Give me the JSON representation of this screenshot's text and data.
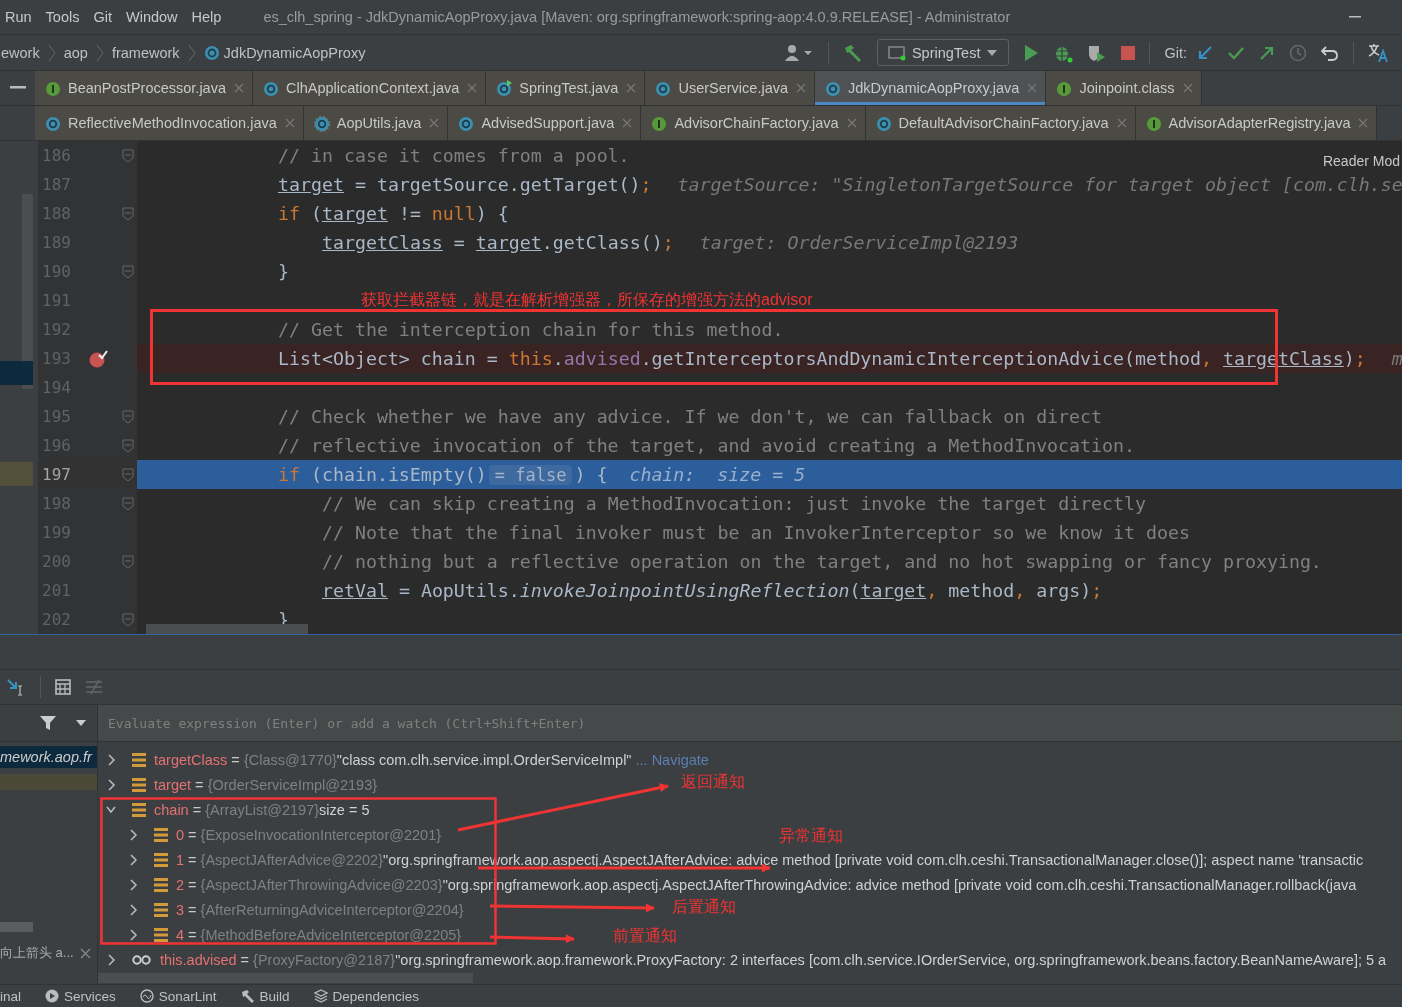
{
  "menu": [
    "Run",
    "Tools",
    "Git",
    "Window",
    "Help"
  ],
  "window": {
    "title": "es_clh_spring - JdkDynamicAopProxy.java [Maven: org.springframework:spring-aop:4.0.9.RELEASE] - Administrator"
  },
  "breadcrumbs": [
    "ework",
    "aop",
    "framework",
    "JdkDynamicAopProxy"
  ],
  "run_config": "SpringTest",
  "git_label": "Git:",
  "tab_rows": [
    [
      {
        "label": "BeanPostProcessor.java",
        "kind": "interface",
        "selected": false
      },
      {
        "label": "ClhApplicationContext.java",
        "kind": "class",
        "selected": false
      },
      {
        "label": "SpringTest.java",
        "kind": "runnable",
        "selected": false
      },
      {
        "label": "UserService.java",
        "kind": "class",
        "selected": false
      },
      {
        "label": "JdkDynamicAopProxy.java",
        "kind": "class",
        "selected": true
      },
      {
        "label": "Joinpoint.class",
        "kind": "interface",
        "selected": false
      }
    ],
    [
      {
        "label": "ReflectiveMethodInvocation.java",
        "kind": "class",
        "selected": false
      },
      {
        "label": "AopUtils.java",
        "kind": "abstract",
        "selected": false
      },
      {
        "label": "AdvisedSupport.java",
        "kind": "class",
        "selected": false
      },
      {
        "label": "AdvisorChainFactory.java",
        "kind": "interface",
        "selected": false
      },
      {
        "label": "DefaultAdvisorChainFactory.java",
        "kind": "class",
        "selected": false
      },
      {
        "label": "AdvisorAdapterRegistry.java",
        "kind": "interface",
        "selected": false
      }
    ]
  ],
  "reader_mode": "Reader Mod",
  "code_lines": [
    {
      "number": "186",
      "nested": false,
      "fold": true,
      "breakpoint": false,
      "current": false,
      "tokens": [
        {
          "kind": "comment",
          "text": "// in case it comes from a pool."
        }
      ]
    },
    {
      "number": "187",
      "nested": false,
      "fold": false,
      "breakpoint": false,
      "current": false,
      "tokens": [
        {
          "kind": "var",
          "text": "target"
        },
        {
          "kind": "plain",
          "text": " = targetSource.getTarget()"
        },
        {
          "kind": "punct",
          "text": ";"
        },
        {
          "kind": "hint",
          "text": "targetSource: \"SingletonTargetSource for target object [com.clh.se"
        }
      ]
    },
    {
      "number": "188",
      "nested": false,
      "fold": true,
      "breakpoint": false,
      "current": false,
      "tokens": [
        {
          "kind": "kw",
          "text": "if"
        },
        {
          "kind": "plain",
          "text": " ("
        },
        {
          "kind": "var",
          "text": "target"
        },
        {
          "kind": "plain",
          "text": " != "
        },
        {
          "kind": "kw",
          "text": "null"
        },
        {
          "kind": "plain",
          "text": ") {"
        }
      ]
    },
    {
      "number": "189",
      "nested": true,
      "fold": false,
      "breakpoint": false,
      "current": false,
      "tokens": [
        {
          "kind": "var",
          "text": "targetClass"
        },
        {
          "kind": "plain",
          "text": " = "
        },
        {
          "kind": "var",
          "text": "target"
        },
        {
          "kind": "plain",
          "text": ".getClass()"
        },
        {
          "kind": "punct",
          "text": ";"
        },
        {
          "kind": "hint",
          "text": "target: OrderServiceImpl@2193"
        }
      ]
    },
    {
      "number": "190",
      "nested": false,
      "fold": true,
      "breakpoint": false,
      "current": false,
      "tokens": [
        {
          "kind": "plain",
          "text": "}"
        }
      ]
    },
    {
      "number": "191",
      "nested": false,
      "fold": false,
      "breakpoint": false,
      "current": false,
      "tokens": [
        {
          "kind": "note",
          "text": "获取拦截器链，就是在解析增强器，所保存的增强方法的advisor"
        }
      ]
    },
    {
      "number": "192",
      "nested": false,
      "fold": false,
      "breakpoint": false,
      "current": false,
      "tokens": [
        {
          "kind": "comment",
          "text": "// Get the interception chain for this method."
        }
      ]
    },
    {
      "number": "193",
      "nested": false,
      "fold": false,
      "breakpoint": true,
      "current": false,
      "tokens": [
        {
          "kind": "plain",
          "text": "List<Object> chain = "
        },
        {
          "kind": "kw",
          "text": "this"
        },
        {
          "kind": "plain",
          "text": "."
        },
        {
          "kind": "field",
          "text": "advised"
        },
        {
          "kind": "plain",
          "text": ".getInterceptorsAndDynamicInterceptionAdvice(method"
        },
        {
          "kind": "punct",
          "text": ", "
        },
        {
          "kind": "var",
          "text": "targetClass"
        },
        {
          "kind": "plain",
          "text": ")"
        },
        {
          "kind": "punct",
          "text": ";"
        },
        {
          "kind": "hint",
          "text": "m"
        }
      ]
    },
    {
      "number": "194",
      "fold": false,
      "breakpoint": false,
      "current": false
    },
    {
      "number": "195",
      "nested": false,
      "fold": true,
      "breakpoint": false,
      "current": false,
      "tokens": [
        {
          "kind": "comment",
          "text": "// Check whether we have any advice. If we don't, we can fallback on direct"
        }
      ]
    },
    {
      "number": "196",
      "nested": false,
      "fold": true,
      "breakpoint": false,
      "current": false,
      "tokens": [
        {
          "kind": "comment",
          "text": "// reflective invocation of the target, and avoid creating a MethodInvocation."
        }
      ]
    },
    {
      "number": "197",
      "nested": false,
      "fold": true,
      "breakpoint": false,
      "current": true,
      "tokens": [
        {
          "kind": "kw",
          "text": "if"
        },
        {
          "kind": "plain",
          "text": " (chain.isEmpty()"
        },
        {
          "kind": "badge",
          "text": "= false"
        },
        {
          "kind": "plain",
          "text": ") {"
        },
        {
          "kind": "hint",
          "text": "chain:  size = 5"
        }
      ]
    },
    {
      "number": "198",
      "nested": true,
      "fold": true,
      "breakpoint": false,
      "current": false,
      "tokens": [
        {
          "kind": "comment",
          "text": "// We can skip creating a MethodInvocation: just invoke the target directly"
        }
      ]
    },
    {
      "number": "199",
      "nested": true,
      "fold": false,
      "breakpoint": false,
      "current": false,
      "tokens": [
        {
          "kind": "comment",
          "text": "// Note that the final invoker must be an InvokerInterceptor so we know it does"
        }
      ]
    },
    {
      "number": "200",
      "nested": true,
      "fold": true,
      "breakpoint": false,
      "current": false,
      "tokens": [
        {
          "kind": "comment",
          "text": "// nothing but a reflective operation on the target, and no hot swapping or fancy proxying."
        }
      ]
    },
    {
      "number": "201",
      "nested": true,
      "fold": false,
      "breakpoint": false,
      "current": false,
      "tokens": [
        {
          "kind": "var",
          "text": "retVal"
        },
        {
          "kind": "plain",
          "text": " = AopUtils."
        },
        {
          "kind": "static",
          "text": "invokeJoinpointUsingReflection"
        },
        {
          "kind": "plain",
          "text": "("
        },
        {
          "kind": "var",
          "text": "target"
        },
        {
          "kind": "punct",
          "text": ", "
        },
        {
          "kind": "plain",
          "text": "method"
        },
        {
          "kind": "punct",
          "text": ", "
        },
        {
          "kind": "plain",
          "text": "args)"
        },
        {
          "kind": "punct",
          "text": ";"
        }
      ]
    },
    {
      "number": "202",
      "nested": false,
      "fold": true,
      "breakpoint": false,
      "current": false,
      "tokens": [
        {
          "kind": "plain",
          "text": "}"
        }
      ]
    }
  ],
  "debugger": {
    "watch_placeholder": "Evaluate expression (Enter) or add a watch (Ctrl+Shift+Enter)",
    "frames": [
      {
        "label": "mework.aop.fr",
        "selected": true
      },
      {
        "label": "向上箭头 a...",
        "selected": false
      }
    ],
    "variables": [
      {
        "kind": "field",
        "name": "targetClass",
        "sep": "=",
        "type": "{Class@1770}",
        "value": "\"class com.clh.service.impl.OrderServiceImpl\"",
        "link": "... Navigate",
        "expanded": false
      },
      {
        "kind": "field",
        "name": "target",
        "sep": "=",
        "type": "{OrderServiceImpl@2193}",
        "expanded": false
      },
      {
        "kind": "field",
        "name": "chain",
        "sep": "=",
        "type": "{ArrayList@2197}",
        "value": "size = 5",
        "expanded": true,
        "children": [
          {
            "kind": "field",
            "name": "0",
            "sep": "=",
            "type": "{ExposeInvocationInterceptor@2201}",
            "expanded": false
          },
          {
            "kind": "field",
            "name": "1",
            "sep": "=",
            "type": "{AspectJAfterAdvice@2202}",
            "value": "\"org.springframework.aop.aspectj.AspectJAfterAdvice: advice method [private void com.clh.ceshi.TransactionalManager.close()]; aspect name 'transactic",
            "expanded": false
          },
          {
            "kind": "field",
            "name": "2",
            "sep": "=",
            "type": "{AspectJAfterThrowingAdvice@2203}",
            "value": "\"org.springframework.aop.aspectj.AspectJAfterThrowingAdvice: advice method [private void com.clh.ceshi.TransactionalManager.rollback(java",
            "expanded": false
          },
          {
            "kind": "field",
            "name": "3",
            "sep": "=",
            "type": "{AfterReturningAdviceInterceptor@2204}",
            "expanded": false
          },
          {
            "kind": "field",
            "name": "4",
            "sep": "=",
            "type": "{MethodBeforeAdviceInterceptor@2205}",
            "expanded": false
          }
        ]
      },
      {
        "kind": "reference",
        "name": "this.advised",
        "sep": "=",
        "type": "{ProxyFactory@2187}",
        "value": "\"org.springframework.aop.framework.ProxyFactory: 2 interfaces [com.clh.service.IOrderService, org.springframework.beans.factory.BeanNameAware]; 5 a",
        "expanded": false
      }
    ]
  },
  "annotations": [
    "返回通知",
    "异常通知",
    "后置通知",
    "前置通知"
  ],
  "status_bar": [
    {
      "label": "inal"
    },
    {
      "label": "Services",
      "kind": "services"
    },
    {
      "label": "SonarLint",
      "kind": "sonar"
    },
    {
      "label": "Build",
      "kind": "build"
    },
    {
      "label": "Dependencies",
      "kind": "deps"
    }
  ]
}
